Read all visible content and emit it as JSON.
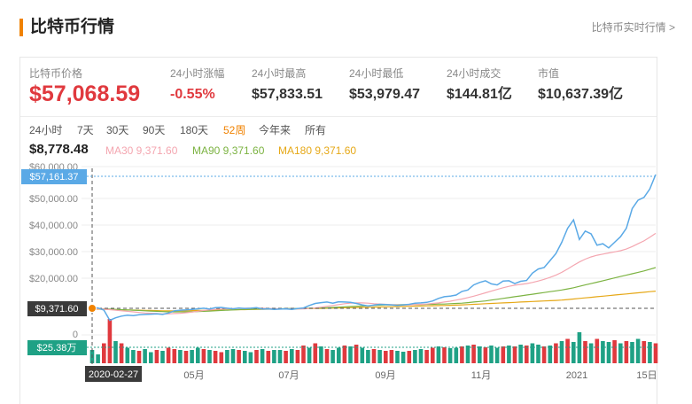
{
  "header": {
    "title": "比特币行情",
    "link_label": "比特币实时行情 >"
  },
  "stats": [
    {
      "label": "比特币价格",
      "value": "$57,068.59"
    },
    {
      "label": "24小时涨幅",
      "value": "-0.55%"
    },
    {
      "label": "24小时最高",
      "value": "$57,833.51"
    },
    {
      "label": "24小时最低",
      "value": "$53,979.47"
    },
    {
      "label": "24小时成交",
      "value": "$144.81亿"
    },
    {
      "label": "市值",
      "value": "$10,637.39亿"
    }
  ],
  "ranges": [
    "24小时",
    "7天",
    "30天",
    "90天",
    "180天",
    "52周",
    "今年来",
    "所有"
  ],
  "active_range": "52周",
  "ma": {
    "main": "$8,778.48",
    "ma30": "MA30 9,371.60",
    "ma90": "MA90 9,371.60",
    "ma180": "MA180 9,371.60"
  },
  "colors": {
    "accent": "#f08200",
    "up": "#e0393e",
    "down": "#1fa185",
    "price_line": "#5aa9e6",
    "ma30": "#f4a6b0",
    "ma90": "#7cb342",
    "ma180": "#e6a817"
  },
  "chart_data": {
    "type": "line",
    "y_ticks": [
      "$60,000.00",
      "$50,000.00",
      "$40,000.00",
      "$30,000.00",
      "$20,000.00",
      "0"
    ],
    "ylim": [
      0,
      60000
    ],
    "x_ticks": [
      "05月",
      "07月",
      "09月",
      "11月",
      "2021",
      "15日"
    ],
    "crosshair": {
      "date": "2020-02-27",
      "price_label": "$9,371.60",
      "volume_label": "$25.38万"
    },
    "top_marker": "$57,161.37",
    "series": [
      {
        "name": "price",
        "values": [
          9700,
          9600,
          8800,
          5200,
          6100,
          6700,
          7000,
          6900,
          7200,
          7300,
          7400,
          7500,
          7300,
          7800,
          8600,
          8800,
          8900,
          9100,
          9300,
          9500,
          9200,
          9700,
          9800,
          9500,
          9300,
          9600,
          9400,
          9500,
          9700,
          9200,
          9300,
          9100,
          9200,
          9300,
          9100,
          9400,
          9600,
          10500,
          11200,
          11500,
          11700,
          11300,
          11800,
          11700,
          11600,
          11200,
          10700,
          10300,
          10600,
          10900,
          10800,
          10700,
          10500,
          10700,
          10900,
          11300,
          11400,
          11600,
          12100,
          13000,
          13600,
          13800,
          14200,
          15500,
          16000,
          17800,
          18700,
          19300,
          18200,
          17800,
          19200,
          19300,
          18300,
          19100,
          19400,
          22000,
          23500,
          24000,
          26500,
          29000,
          33000,
          38000,
          41000,
          34000,
          37000,
          36000,
          32000,
          32500,
          31000,
          33000,
          35000,
          38000,
          45000,
          48000,
          49000,
          52000,
          57161
        ]
      },
      {
        "name": "MA30",
        "values": [
          9400,
          9300,
          9200,
          9000,
          8800,
          8600,
          8400,
          8200,
          8000,
          7800,
          7700,
          7600,
          7500,
          7500,
          7600,
          7700,
          7900,
          8100,
          8400,
          8700,
          8900,
          9100,
          9200,
          9300,
          9400,
          9400,
          9500,
          9500,
          9500,
          9500,
          9400,
          9400,
          9300,
          9300,
          9300,
          9300,
          9300,
          9400,
          9600,
          9900,
          10200,
          10500,
          10800,
          11100,
          11300,
          11400,
          11400,
          11300,
          11100,
          11000,
          10900,
          10800,
          10700,
          10700,
          10700,
          10800,
          10900,
          11000,
          11200,
          11400,
          11700,
          12000,
          12400,
          12800,
          13300,
          13800,
          14400,
          15000,
          15600,
          16200,
          16800,
          17300,
          17700,
          18000,
          18300,
          18700,
          19200,
          19800,
          20500,
          21300,
          22300,
          23500,
          24800,
          26000,
          27000,
          27800,
          28400,
          28800,
          29200,
          29600,
          30000,
          30600,
          31500,
          32500,
          33500,
          34800,
          36200
        ]
      },
      {
        "name": "MA90",
        "values": [
          9400,
          9350,
          9300,
          9200,
          9100,
          9000,
          8900,
          8800,
          8700,
          8600,
          8500,
          8400,
          8300,
          8200,
          8200,
          8200,
          8200,
          8200,
          8300,
          8400,
          8500,
          8600,
          8700,
          8800,
          8900,
          9000,
          9100,
          9100,
          9200,
          9200,
          9300,
          9300,
          9300,
          9400,
          9400,
          9400,
          9400,
          9500,
          9500,
          9600,
          9700,
          9800,
          9900,
          10000,
          10100,
          10200,
          10300,
          10400,
          10500,
          10600,
          10700,
          10700,
          10800,
          10800,
          10800,
          10800,
          10800,
          10900,
          10900,
          11000,
          11000,
          11100,
          11200,
          11300,
          11500,
          11700,
          11900,
          12100,
          12400,
          12700,
          13000,
          13300,
          13600,
          13900,
          14200,
          14500,
          14800,
          15100,
          15400,
          15700,
          16000,
          16400,
          16800,
          17300,
          17800,
          18300,
          18800,
          19300,
          19800,
          20300,
          20800,
          21300,
          21800,
          22300,
          22800,
          23400,
          24000
        ]
      },
      {
        "name": "MA180",
        "values": [
          9200,
          9150,
          9100,
          9050,
          9000,
          8950,
          8900,
          8850,
          8800,
          8750,
          8700,
          8650,
          8600,
          8600,
          8600,
          8600,
          8600,
          8650,
          8700,
          8700,
          8750,
          8800,
          8850,
          8900,
          8950,
          9000,
          9000,
          9050,
          9100,
          9100,
          9150,
          9200,
          9200,
          9250,
          9300,
          9300,
          9350,
          9400,
          9400,
          9450,
          9500,
          9550,
          9600,
          9650,
          9700,
          9750,
          9800,
          9850,
          9900,
          9950,
          10000,
          10050,
          10100,
          10150,
          10200,
          10250,
          10300,
          10350,
          10400,
          10450,
          10500,
          10550,
          10600,
          10700,
          10800,
          10900,
          11000,
          11100,
          11200,
          11300,
          11400,
          11500,
          11600,
          11700,
          11800,
          11900,
          12000,
          12100,
          12200,
          12300,
          12400,
          12600,
          12800,
          13000,
          13200,
          13400,
          13600,
          13800,
          14000,
          14200,
          14400,
          14600,
          14800,
          15000,
          15200,
          15400,
          15600
        ]
      }
    ],
    "volumes": [
      0.3,
      0.2,
      0.45,
      1.0,
      0.5,
      0.45,
      0.35,
      0.3,
      0.28,
      0.32,
      0.25,
      0.3,
      0.28,
      0.35,
      0.32,
      0.3,
      0.28,
      0.3,
      0.35,
      0.32,
      0.3,
      0.28,
      0.25,
      0.3,
      0.32,
      0.3,
      0.28,
      0.25,
      0.3,
      0.32,
      0.28,
      0.3,
      0.3,
      0.28,
      0.32,
      0.3,
      0.4,
      0.35,
      0.45,
      0.38,
      0.32,
      0.3,
      0.35,
      0.4,
      0.38,
      0.42,
      0.35,
      0.3,
      0.32,
      0.3,
      0.28,
      0.3,
      0.28,
      0.26,
      0.28,
      0.3,
      0.32,
      0.3,
      0.35,
      0.38,
      0.36,
      0.34,
      0.35,
      0.38,
      0.4,
      0.42,
      0.38,
      0.36,
      0.4,
      0.35,
      0.38,
      0.4,
      0.38,
      0.42,
      0.4,
      0.45,
      0.42,
      0.38,
      0.4,
      0.45,
      0.5,
      0.55,
      0.48,
      0.7,
      0.5,
      0.45,
      0.55,
      0.5,
      0.48,
      0.52,
      0.45,
      0.5,
      0.48,
      0.55,
      0.5,
      0.48,
      0.45
    ],
    "volume_up": [
      0,
      0,
      1,
      1,
      0,
      1,
      0,
      0,
      1,
      0,
      0,
      1,
      0,
      1,
      1,
      0,
      1,
      0,
      0,
      1,
      0,
      1,
      1,
      0,
      0,
      1,
      0,
      0,
      1,
      0,
      1,
      0,
      0,
      1,
      0,
      1,
      1,
      0,
      1,
      0,
      1,
      0,
      0,
      1,
      0,
      1,
      0,
      0,
      1,
      0,
      1,
      1,
      0,
      0,
      1,
      0,
      0,
      1,
      1,
      0,
      1,
      0,
      0,
      1,
      0,
      1,
      0,
      1,
      0,
      0,
      1,
      0,
      1,
      0,
      1,
      0,
      0,
      1,
      0,
      1,
      0,
      1,
      0,
      0,
      1,
      0,
      1,
      0,
      0,
      1,
      0,
      1,
      0,
      0,
      1,
      0,
      1
    ]
  }
}
